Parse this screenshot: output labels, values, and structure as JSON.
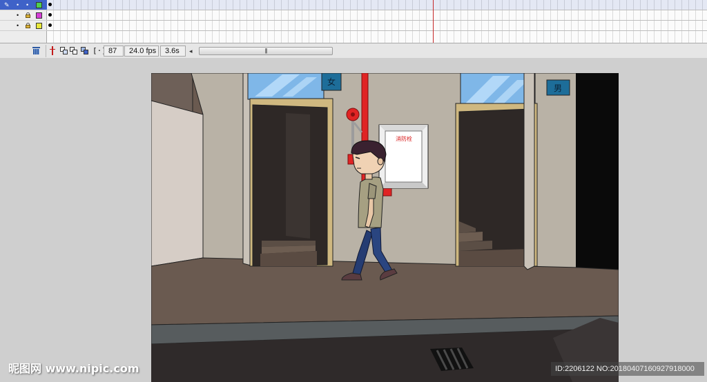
{
  "timeline": {
    "layers": [
      {
        "active": true,
        "color": "#4fcf4f",
        "name": ""
      },
      {
        "active": false,
        "color": "#d63fd6",
        "name": ""
      },
      {
        "active": false,
        "color": "#e8e83a",
        "name": ""
      }
    ],
    "frame_number": "87",
    "frame_rate": "24.0 fps",
    "elapsed_time": "3.6s",
    "scroll_thumb_grip": "|||"
  },
  "stage": {
    "sign_women": "女",
    "sign_men": "男",
    "notice_title": "消防栓"
  },
  "watermark": {
    "site": "昵图网 www.nipic.com",
    "id_text": "ID:2206122 NO:20180407160927918000"
  },
  "colors": {
    "playhead": "#c62828",
    "active_layer": "#3f62c8",
    "fire_pipe": "#e02424"
  }
}
